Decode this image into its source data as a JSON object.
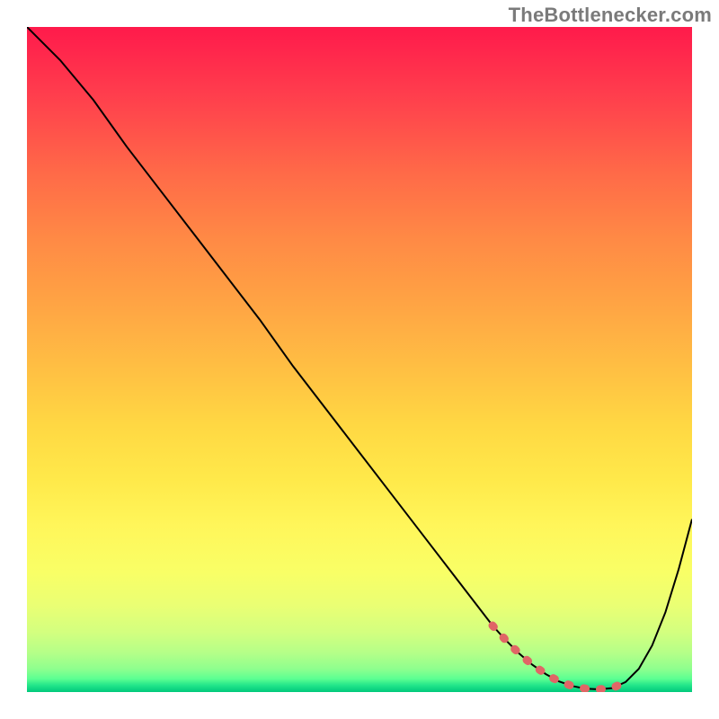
{
  "attribution": "TheBottlenecker.com",
  "chart_data": {
    "type": "line",
    "title": "",
    "xlabel": "",
    "ylabel": "",
    "xlim": [
      0,
      100
    ],
    "ylim": [
      0,
      100
    ],
    "x": [
      0,
      5,
      10,
      15,
      20,
      25,
      30,
      35,
      40,
      45,
      50,
      55,
      60,
      65,
      70,
      72,
      74,
      76,
      78,
      80,
      82,
      84,
      86,
      88,
      90,
      92,
      94,
      96,
      98,
      100
    ],
    "values": [
      100,
      95,
      89,
      82,
      75.5,
      69,
      62.5,
      56,
      49,
      42.5,
      36,
      29.5,
      23,
      16.5,
      10,
      7.8,
      5.8,
      4.1,
      2.7,
      1.6,
      0.9,
      0.5,
      0.4,
      0.6,
      1.5,
      3.5,
      7,
      12,
      18.5,
      26
    ],
    "highlight_range_x": [
      70,
      90
    ],
    "annotations": []
  }
}
